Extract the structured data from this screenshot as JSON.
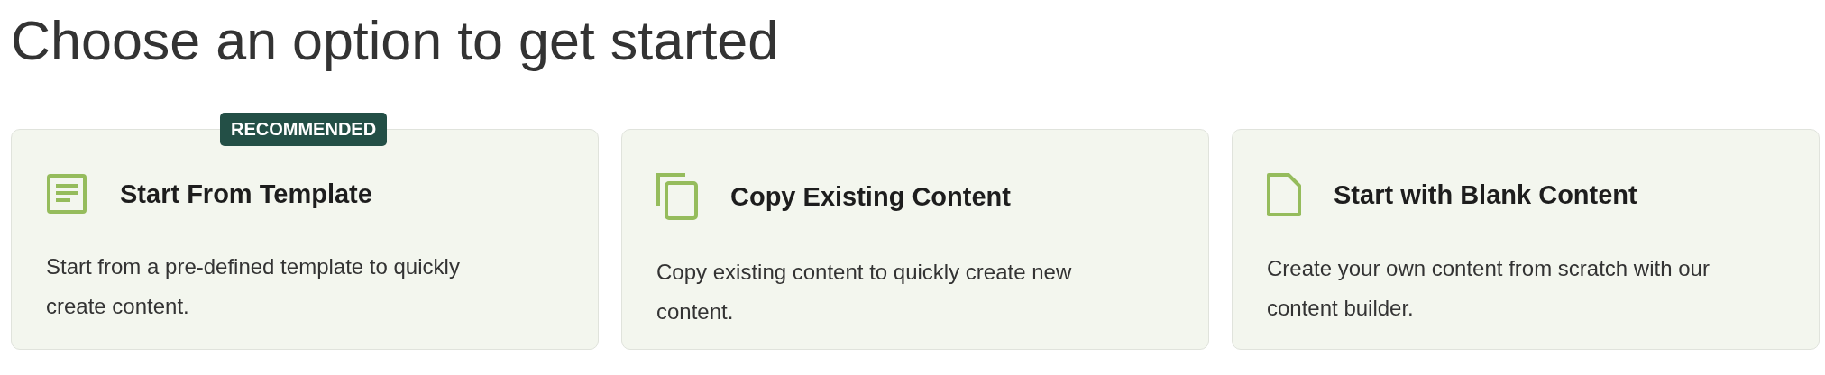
{
  "title": "Choose an option to get started",
  "options": [
    {
      "kind": "template",
      "badge": "RECOMMENDED",
      "title": "Start From Template",
      "description": "Start from a pre-defined template to quickly create content."
    },
    {
      "kind": "copy",
      "title": "Copy Existing Content",
      "description": "Copy existing content to quickly create new content."
    },
    {
      "kind": "blank",
      "title": "Start with Blank Content",
      "description": "Create your own content from scratch with our content builder."
    }
  ]
}
